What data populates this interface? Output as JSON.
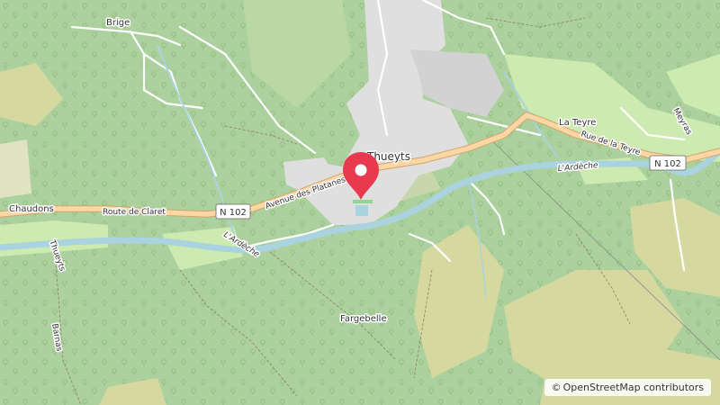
{
  "map": {
    "colors": {
      "forest": "#add19e",
      "meadow": "#cdebb0",
      "scrub": "#c8d7ab",
      "heath": "#d6d99f",
      "residential": "#e0dfdf",
      "industrial": "#d2d2d2",
      "river": "#aad3df",
      "road_primary": "#fcd6a4",
      "road_casing": "#d0a56a",
      "marker": "#e8394d"
    },
    "labels": {
      "brige": "Brige",
      "thueyts": "Thueyts",
      "la_teyre": "La Teyre",
      "rue_de_la_teyre": "Rue de la Teyre",
      "meyras": "Meyras",
      "chaudons": "Chaudons",
      "route_de_claret": "Route de Claret",
      "avenue_des_platanes": "Avenue des Platanes",
      "n102_west": "N 102",
      "n102_east": "N 102",
      "ardeche_west": "L'Ardèche",
      "ardeche_east": "L'Ardèche",
      "thueyts_road": "Thueyts",
      "barnas": "Barnas",
      "fargebelle": "Fargebelle"
    },
    "attribution": {
      "symbol": "©",
      "text": "OpenStreetMap contributors"
    }
  }
}
